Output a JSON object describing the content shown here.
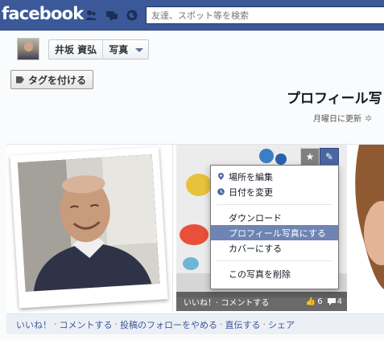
{
  "topbar": {
    "logo": "facebook",
    "search_placeholder": "友達、スポット等を検索",
    "icons": [
      "friend-requests-icon",
      "messages-icon",
      "notifications-icon"
    ],
    "bg_color": "#3b5998"
  },
  "header": {
    "profile_name": "井坂 資弘",
    "section": "写真",
    "tag_button": "タグを付ける",
    "album_title": "プロフィール写",
    "updated": "月曜日に更新"
  },
  "photo_bar": {
    "actions": "いいね！· コメントする",
    "likes": "6",
    "comments": "4"
  },
  "menu": {
    "items": [
      {
        "label": "場所を編集",
        "icon": "location-pin-icon"
      },
      {
        "label": "日付を変更",
        "icon": "clock-icon"
      },
      {
        "label": "ダウンロード"
      },
      {
        "label": "プロフィール写真にする",
        "highlighted": true
      },
      {
        "label": "カバーにする"
      },
      {
        "label": "この写真を削除"
      }
    ],
    "highlight_color": "#6d84b4"
  },
  "footer": {
    "links": [
      "いいね！",
      "コメントする",
      "投稿のフォローをやめる",
      "直伝する",
      "シェア"
    ]
  }
}
